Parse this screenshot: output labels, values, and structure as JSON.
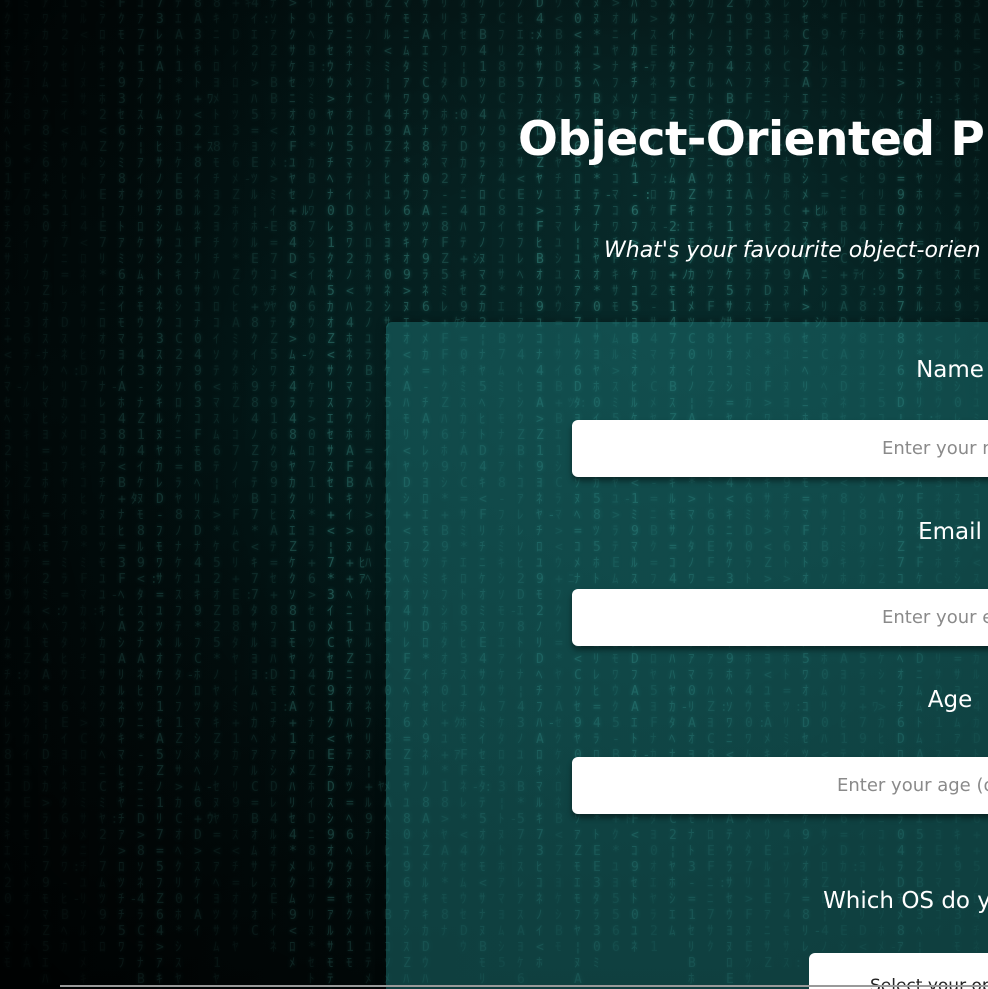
{
  "page": {
    "title": "Object-Oriented Prog",
    "subtitle": "What's your favourite object-orien"
  },
  "form": {
    "fields": [
      {
        "label": "Name",
        "placeholder": "Enter your na"
      },
      {
        "label": "Email",
        "placeholder": "Enter your er"
      },
      {
        "label": "Age",
        "placeholder": "Enter your age (op"
      }
    ],
    "os_question": {
      "label": "Which OS do y",
      "select_value": "Select your op"
    }
  },
  "colors": {
    "background": "#021414",
    "panel": "#1c6e6e",
    "input_bg": "#ffffff",
    "text": "#ffffff",
    "rain": "#5ac8be"
  },
  "background_art": "matrix-code-rain"
}
